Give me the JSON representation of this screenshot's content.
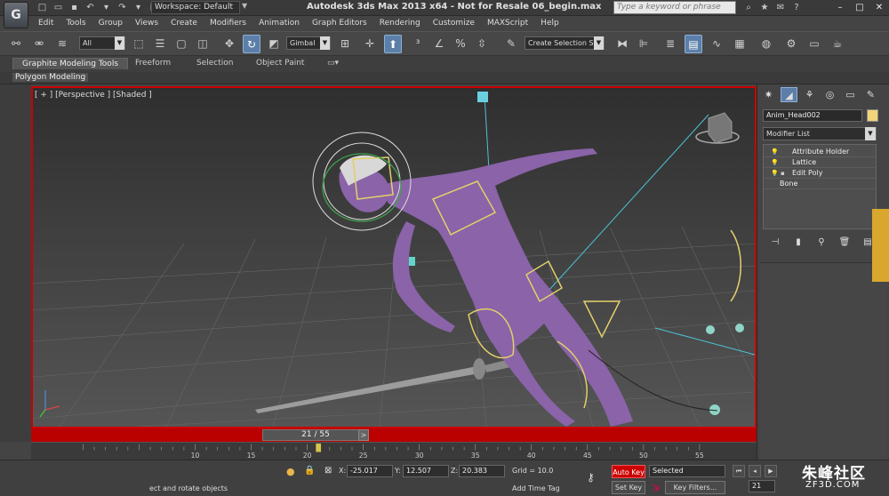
{
  "titlebar": {
    "workspace": "Workspace: Default",
    "title": "Autodesk 3ds Max  2013 x64    - Not for Resale    06_begin.max",
    "help_placeholder": "Type a keyword or phrase"
  },
  "menu": [
    "Edit",
    "Tools",
    "Group",
    "Views",
    "Create",
    "Modifiers",
    "Animation",
    "Graph Editors",
    "Rendering",
    "Customize",
    "MAXScript",
    "Help"
  ],
  "toolbar": {
    "selection_filter": "All",
    "ref_coord": "Gimbal",
    "named_selection": "Create Selection Se"
  },
  "ribbon": {
    "tabs": [
      "Graphite Modeling Tools",
      "Freeform",
      "Selection",
      "Object Paint"
    ],
    "panel": "Polygon Modeling"
  },
  "viewport": {
    "label": "[ + ] [Perspective ] [Shaded ]"
  },
  "timeline": {
    "frame": "21 / 55",
    "ticks": [
      10,
      15,
      20,
      25,
      30,
      35,
      40,
      45,
      50,
      55
    ],
    "current": 21,
    "range": [
      0,
      55
    ]
  },
  "status": {
    "prompt": "ect and rotate objects",
    "x_label": "X:",
    "x": "-25.017",
    "y_label": "Y:",
    "y": "12.507",
    "z_label": "Z:",
    "z": "20.383",
    "grid": "Grid = 10.0",
    "add_time_tag": "Add Time Tag",
    "auto_key": "Auto Key",
    "set_key": "Set Key",
    "key_mode": "Selected",
    "key_filters": "Key Filters...",
    "current_frame": "21"
  },
  "command_panel": {
    "object_name": "Anim_Head002",
    "object_color": "#f2d479",
    "modifier_list": "Modifier List",
    "stack": [
      "Attribute Holder",
      "Lattice",
      "Edit Poly",
      "Bone"
    ]
  },
  "watermark": {
    "name": "朱峰社区",
    "site": "ZF3D.COM"
  }
}
